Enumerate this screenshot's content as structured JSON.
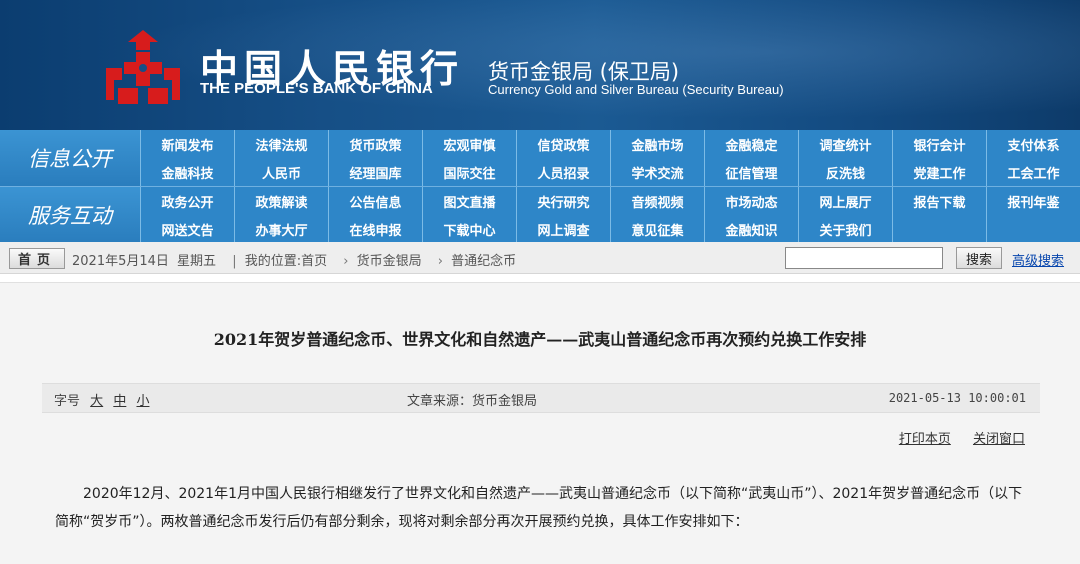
{
  "header": {
    "bank_name_cn": "中国人民银行",
    "bank_name_en": "THE PEOPLE'S BANK OF CHINA",
    "bureau_cn": "货币金银局 (保卫局)",
    "bureau_en": "Currency Gold and Silver Bureau (Security Bureau)",
    "logo_icon": "pboc-logo-icon",
    "colors": {
      "banner": "#164f86",
      "logo_red": "#d71c1c",
      "nav": "#2e86c8"
    }
  },
  "nav": {
    "groups": [
      {
        "label": "信息公开",
        "items": [
          "新闻发布",
          "法律法规",
          "货币政策",
          "宏观审慎",
          "信贷政策",
          "金融市场",
          "金融稳定",
          "调查统计",
          "银行会计",
          "支付体系",
          "金融科技",
          "人民币",
          "经理国库",
          "国际交往",
          "人员招录",
          "学术交流",
          "征信管理",
          "反洗钱",
          "党建工作",
          "工会工作"
        ]
      },
      {
        "label": "服务互动",
        "items": [
          "政务公开",
          "政策解读",
          "公告信息",
          "图文直播",
          "央行研究",
          "音频视频",
          "市场动态",
          "网上展厅",
          "报告下载",
          "报刊年鉴",
          "网送文告",
          "办事大厅",
          "在线申报",
          "下载中心",
          "网上调查",
          "意见征集",
          "金融知识",
          "关于我们",
          "",
          ""
        ]
      }
    ]
  },
  "crumbbar": {
    "home_label": "首页",
    "date": "2021年5月14日",
    "weekday": "星期五",
    "location_prefix": "我的位置:首页",
    "crumb_sep": "›",
    "crumb_1": "货币金银局",
    "crumb_2": "普通纪念币",
    "search_value": "",
    "search_button": "搜索",
    "advanced_search": "高级搜索"
  },
  "article": {
    "title": "2021年贺岁普通纪念币、世界文化和自然遗产——武夷山普通纪念币再次预约兑换工作安排",
    "font_size_label": "字号",
    "font_sizes": [
      "大",
      "中",
      "小"
    ],
    "source": "文章来源：货币金银局",
    "pubtime": "2021-05-13 10:00:01",
    "print_label": "打印本页",
    "close_label": "关闭窗口",
    "paragraph": "2020年12月、2021年1月中国人民银行相继发行了世界文化和自然遗产——武夷山普通纪念币（以下简称“武夷山币”）、2021年贺岁普通纪念币（以下简称“贺岁币”）。两枚普通纪念币发行后仍有部分剩余，现将对剩余部分再次开展预约兑换，具体工作安排如下："
  }
}
